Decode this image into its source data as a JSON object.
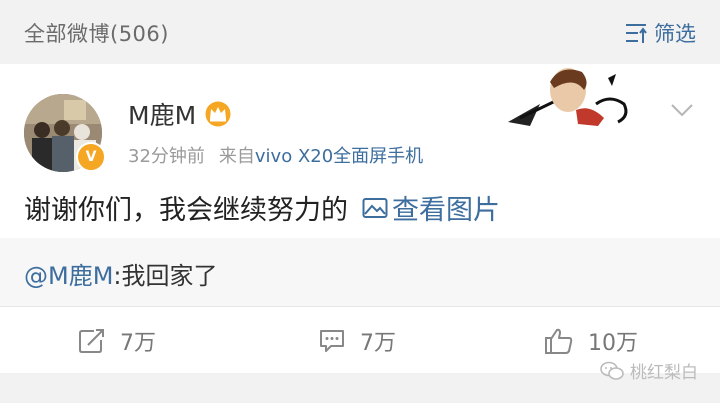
{
  "header": {
    "title": "全部微博(506)",
    "filter_label": "筛选"
  },
  "post": {
    "username": "M鹿M",
    "time": "32分钟前",
    "source_prefix": "来自",
    "device": "vivo X20全面屏手机",
    "content": "谢谢你们，我会继续努力的",
    "view_images_label": "查看图片",
    "repost_mention": "@M鹿M",
    "repost_text": ":我回家了"
  },
  "actions": {
    "share_count": "7万",
    "comment_count": "7万",
    "like_count": "10万"
  },
  "watermark": "桃红梨白",
  "colors": {
    "link": "#3d6e9e",
    "badge": "#f5a623",
    "crown": "#f5a623"
  }
}
